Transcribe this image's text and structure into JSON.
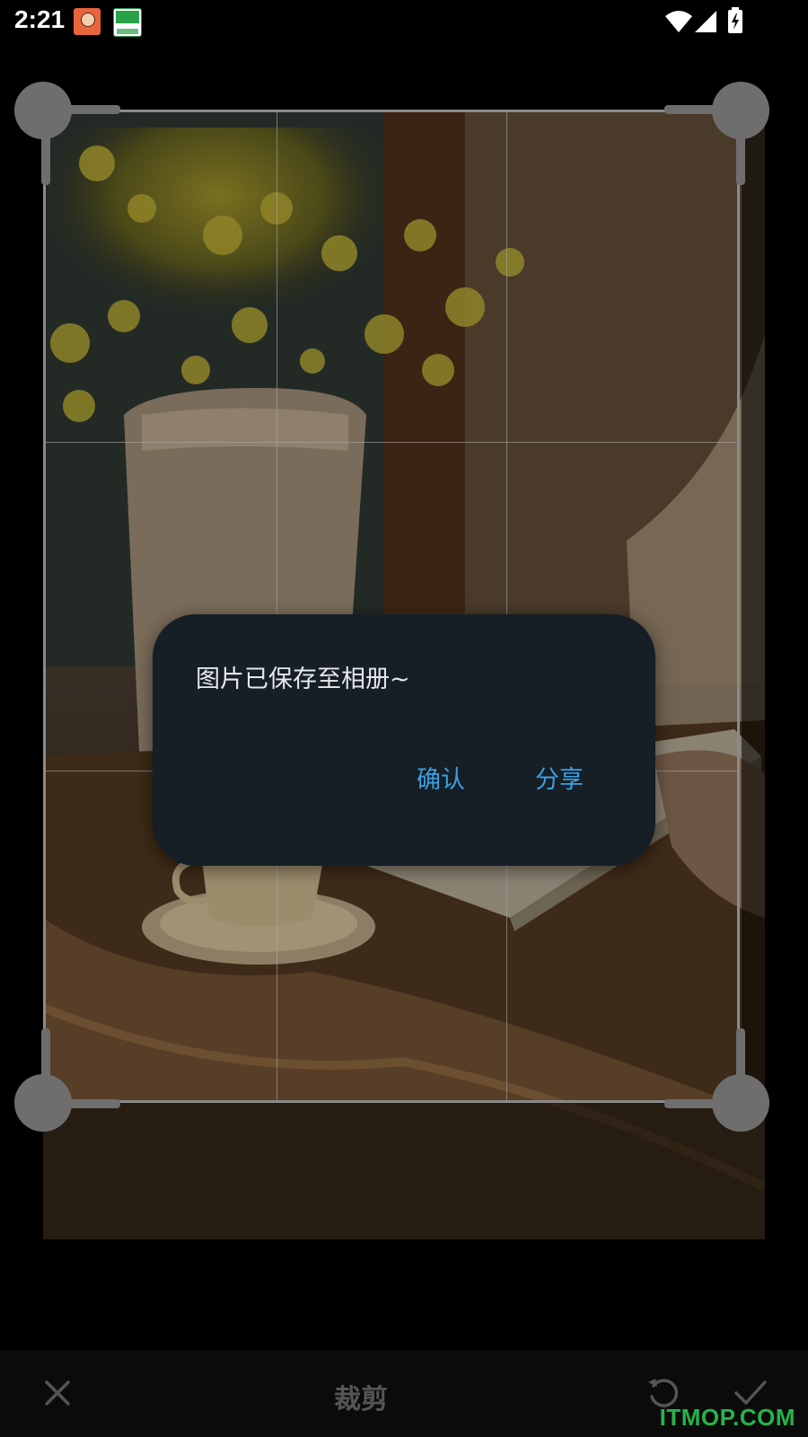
{
  "status_bar": {
    "time": "2:21",
    "notification_icons": [
      "app-notification-icon",
      "app-notification-icon"
    ],
    "system_icons": [
      "wifi-icon",
      "signal-icon",
      "battery-charging-icon"
    ]
  },
  "crop_editor": {
    "photo_description_icon": "photo-image",
    "grid": "3x3"
  },
  "dialog": {
    "message": "图片已保存至相册~",
    "confirm_label": "确认",
    "share_label": "分享"
  },
  "toolbar": {
    "title": "裁剪",
    "cancel_icon": "close-icon",
    "rotate_icon": "rotate-icon",
    "done_icon": "check-icon"
  },
  "watermark": "ITMOP.COM",
  "colors": {
    "dialog_background": "#161e26",
    "dialog_button": "#3ba0e0",
    "handle": "#6e6e6e",
    "watermark": "#27b34a"
  }
}
